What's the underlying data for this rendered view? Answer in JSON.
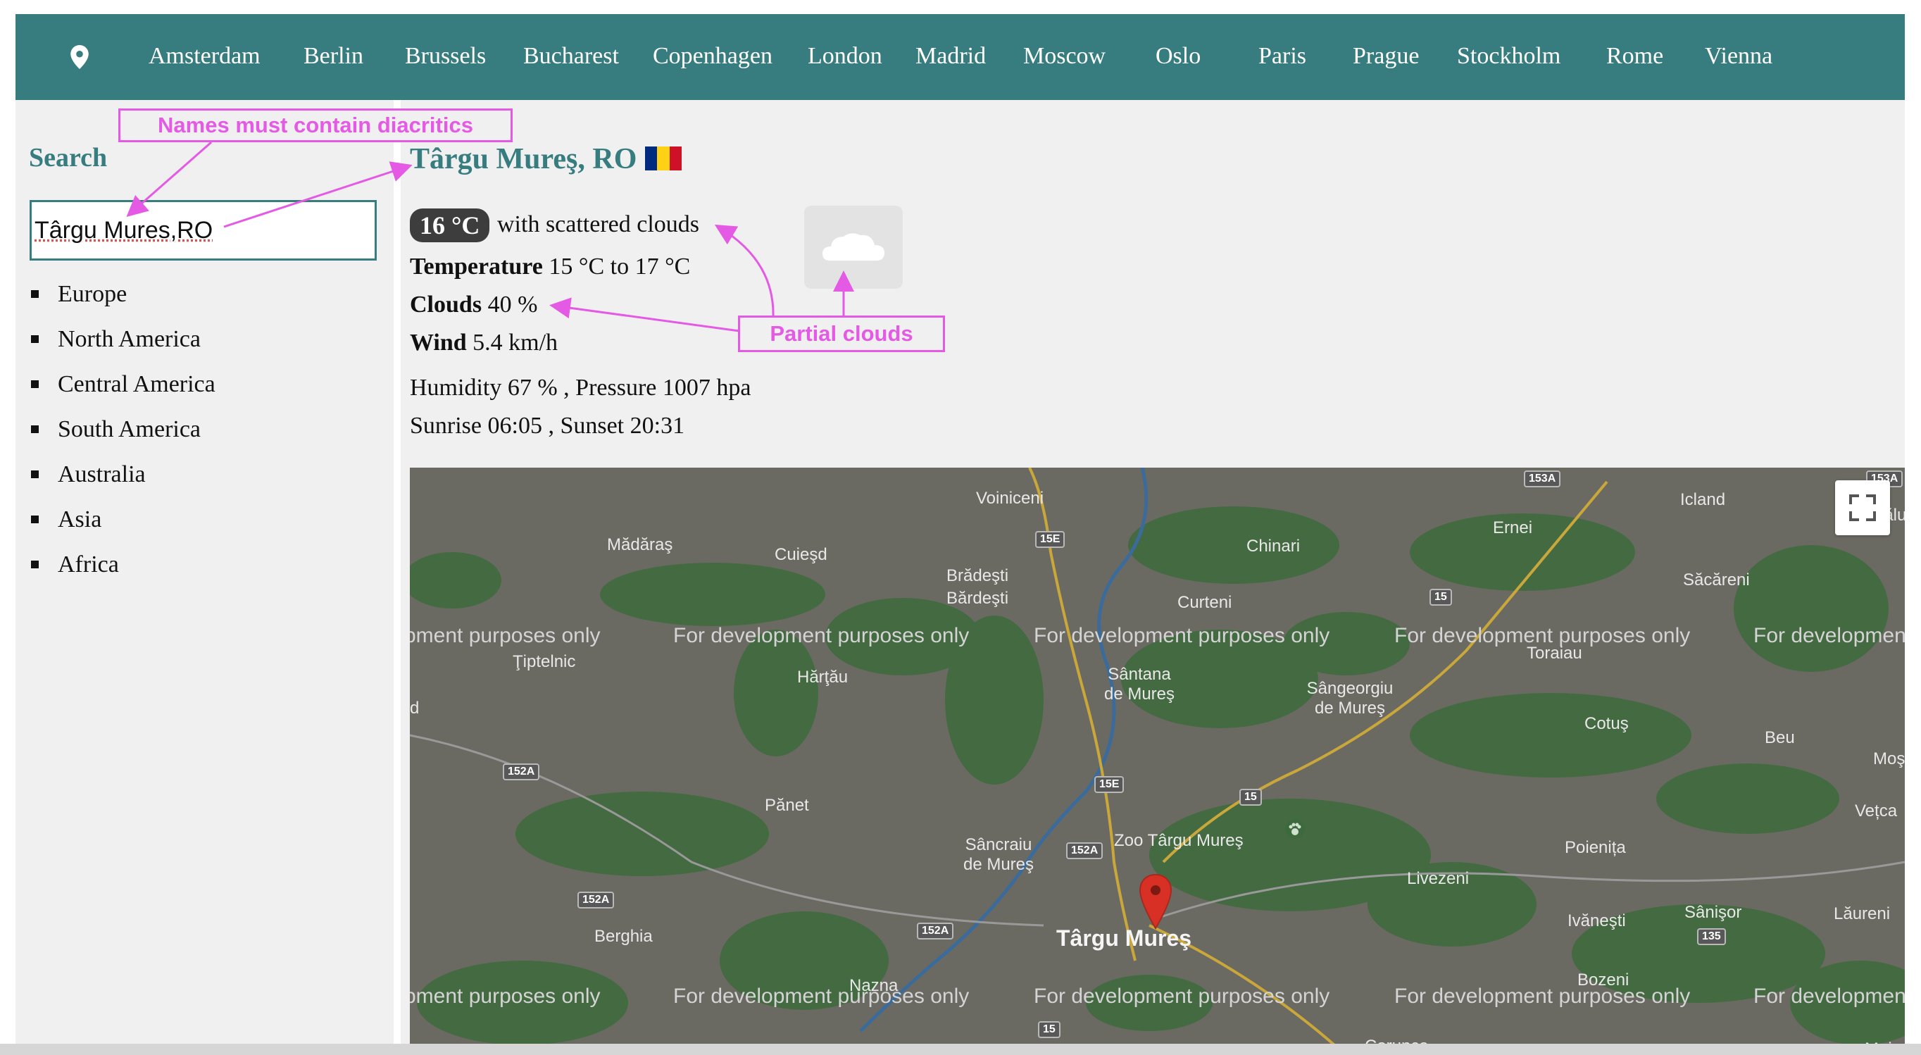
{
  "nav": {
    "cities": [
      "Amsterdam",
      "Berlin",
      "Brussels",
      "Bucharest",
      "Copenhagen",
      "London",
      "Madrid",
      "Moscow",
      "Oslo",
      "Paris",
      "Prague",
      "Stockholm",
      "Rome",
      "Vienna"
    ]
  },
  "sidebar": {
    "search_label": "Search",
    "search_value": "Târgu Mures,RO",
    "regions": [
      "Europe",
      "North America",
      "Central America",
      "South America",
      "Australia",
      "Asia",
      "Africa"
    ]
  },
  "weather": {
    "city_title": "Târgu Mureş, RO",
    "flag_colors": [
      "#002b7f",
      "#fcd116",
      "#ce1126"
    ],
    "temperature_badge": "16 °C",
    "description": "with scattered clouds",
    "icon": "cloud-icon",
    "temperature_label": "Temperature",
    "temperature_value": "15 °C to 17 °C",
    "clouds_label": "Clouds",
    "clouds_value": "40 %",
    "wind_label": "Wind",
    "wind_value": "5.4 km/h",
    "humidity_pressure": "Humidity 67 % , Pressure 1007 hpa",
    "sun": "Sunrise 06:05 , Sunset 20:31"
  },
  "map": {
    "watermark": "For development purposes only",
    "watermark_left_clipped": "pment purposes only",
    "watermark_right_clipped": "For developmen",
    "places": [
      "Voiniceni",
      "Mădăraş",
      "Cuieşd",
      "Chinari",
      "Ernei",
      "Icland",
      "Căluşer",
      "Brădeşti",
      "Bărdeşti",
      "Săcăreni",
      "Curteni",
      "Ţiptelnic",
      "Hărţău",
      "Sântana de Mureş",
      "Sângeorgiu de Mureş",
      "Toraiau",
      "Cotuş",
      "Beu",
      "Moşu",
      "Pănet",
      "Vețca",
      "Zoo Târgu Mureş",
      "Sâncraiu de Mureş",
      "Poienița",
      "Livezeni",
      "Berghia",
      "Sânişor",
      "Lăureni",
      "Ivăneşti",
      "Târgu Mureş",
      "Nazna",
      "Bozeni",
      "Corunca",
      "Maiad",
      "d"
    ],
    "road_shields": [
      "15E",
      "15E",
      "15",
      "15",
      "153A",
      "152A",
      "152A",
      "152A",
      "152A",
      "135",
      "15",
      "153A"
    ],
    "marker_color": "#d93025"
  },
  "annotations": {
    "diacritics_note": "Names must contain diacritics",
    "clouds_note": "Partial clouds",
    "color": "#e55ae4"
  }
}
